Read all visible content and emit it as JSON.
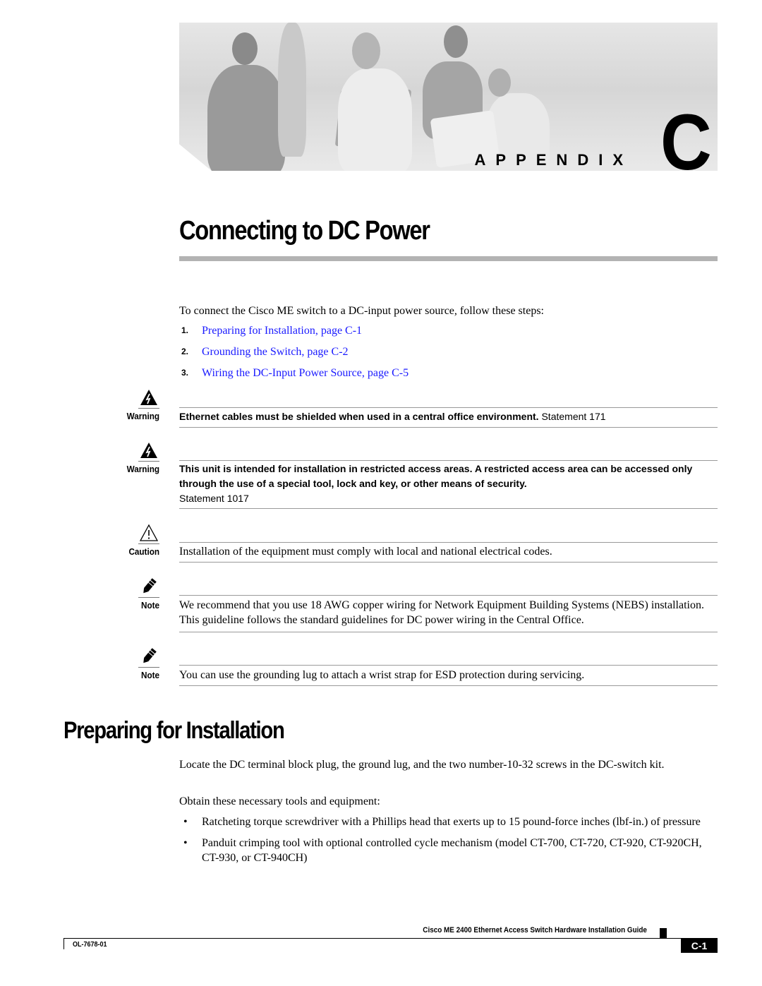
{
  "banner": {
    "appendix_word": "APPENDIX",
    "appendix_letter": "C",
    "image_description": "photo-people-office"
  },
  "chapter_title": "Connecting to DC Power",
  "intro": "To connect the Cisco ME switch to a DC-input power source, follow these steps:",
  "steps": [
    {
      "num": "1.",
      "label": "Preparing for Installation, page C-1"
    },
    {
      "num": "2.",
      "label": "Grounding the Switch, page C-2"
    },
    {
      "num": "3.",
      "label": "Wiring the DC-Input Power Source, page C-5"
    }
  ],
  "notices": [
    {
      "type": "Warning",
      "icon": "warning-lightning-icon",
      "bold_text": "Ethernet cables must be shielded when used in a central office environment.",
      "statement": " Statement 171"
    },
    {
      "type": "Warning",
      "icon": "warning-lightning-icon",
      "bold_text": "This unit is intended for installation in restricted access areas. A restricted access area can be accessed only through the use of a special tool, lock and key, or other means of security.",
      "statement": "Statement 1017"
    },
    {
      "type": "Caution",
      "icon": "caution-triangle-icon",
      "text": "Installation of the equipment must comply with local and national electrical codes."
    },
    {
      "type": "Note",
      "icon": "note-pencil-icon",
      "text": "We recommend that you use 18 AWG copper wiring for Network Equipment Building Systems (NEBS) installation. This guideline follows the standard guidelines for DC power wiring in the Central Office."
    },
    {
      "type": "Note",
      "icon": "note-pencil-icon",
      "text": "You can use the grounding lug to attach a wrist strap for ESD protection during servicing."
    }
  ],
  "section": {
    "title": "Preparing for Installation",
    "p1": "Locate the DC terminal block plug, the ground lug, and the two number-10-32 screws in the DC-switch kit.",
    "p2": "Obtain these necessary tools and equipment:",
    "bullets": [
      "Ratcheting torque screwdriver with a Phillips head that exerts up to 15 pound-force inches (lbf-in.) of pressure",
      "Panduit crimping tool with optional controlled cycle mechanism (model CT-700, CT-720, CT-920, CT-920CH, CT-930, or CT-940CH)"
    ],
    "bullet_glyph": "•"
  },
  "footer": {
    "guide_title": "Cisco ME 2400 Ethernet Access Switch Hardware Installation Guide",
    "doc_number": "OL-7678-01",
    "page": "C-1"
  },
  "colors": {
    "link": "#1a1aff",
    "rule_gray": "#b3b3b3"
  }
}
